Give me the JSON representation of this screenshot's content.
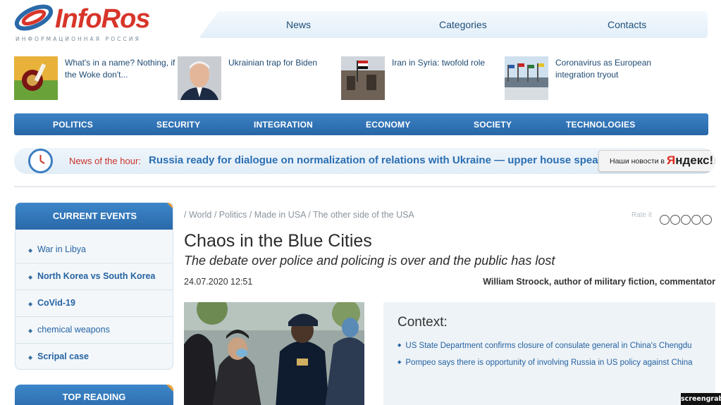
{
  "logo": {
    "brand": "InfoRos",
    "subtitle": "ИНФОРМАЦИОННАЯ РОССИЯ"
  },
  "topnav": {
    "items": [
      "News",
      "Categories",
      "Contacts"
    ]
  },
  "teasers": [
    {
      "title": "What's in a name? Nothing, if the Woke don't..."
    },
    {
      "title": "Ukrainian trap for Biden"
    },
    {
      "title": "Iran in Syria: twofold role"
    },
    {
      "title": "Coronavirus as European integration tryout"
    }
  ],
  "categories": [
    "POLITICS",
    "SECURITY",
    "INTEGRATION",
    "ECONOMY",
    "SOCIETY",
    "TECHNOLOGIES"
  ],
  "news_hour": {
    "label": "News of the hour:",
    "text": "Russia ready for dialogue on normalization of relations with Ukraine — upper house speaker",
    "yandex_prefix": "Наши новости в",
    "yandex_brand_first": "Я",
    "yandex_brand_rest": "ндекс!"
  },
  "sidebar": {
    "title": "CURRENT EVENTS",
    "items": [
      {
        "label": "War in Libya",
        "bold": false
      },
      {
        "label": "North Korea vs South Korea",
        "bold": true
      },
      {
        "label": "CoVid-19",
        "bold": true
      },
      {
        "label": "chemical weapons",
        "bold": false
      },
      {
        "label": "Scripal case",
        "bold": true
      }
    ],
    "second_title": "TOP READING"
  },
  "article": {
    "breadcrumb": "/ World / Politics / Made in USA / The other side of the USA",
    "rate_label": "Rate it",
    "title": "Chaos in the Blue Cities",
    "subtitle": "The debate over police and policing is over and the public has lost",
    "date": "24.07.2020 12:51",
    "author": "William Stroock, author of military fiction, commentator"
  },
  "context": {
    "title": "Context:",
    "items": [
      "US State Department confirms closure of consulate general in China's Chengdu",
      "Pompeo says there is opportunity of involving Russia in US policy against China"
    ]
  },
  "badge": "screengrab",
  "colors": {
    "accent_blue": "#2a69a9",
    "link_blue": "#2563a3",
    "logo_red": "#d8352a",
    "highlight_orange": "#f0a033"
  }
}
